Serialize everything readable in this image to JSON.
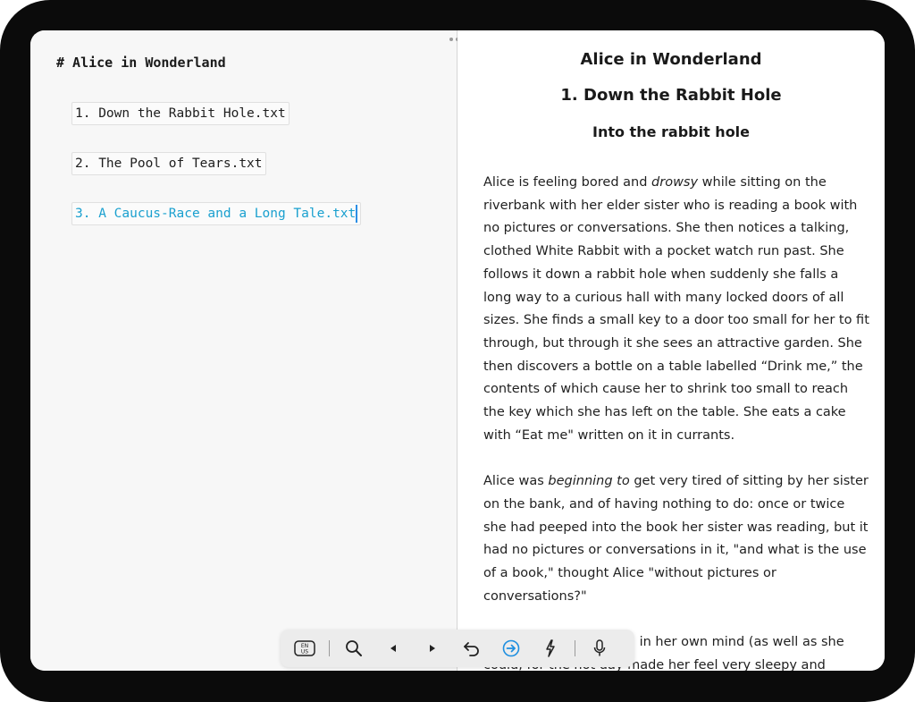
{
  "editor": {
    "heading": "# Alice in Wonderland",
    "files": [
      {
        "label": "1. Down the Rabbit Hole.txt"
      },
      {
        "label": "2. The Pool of Tears.txt"
      },
      {
        "label": "3. A Caucus-Race and a Long Tale.txt"
      }
    ]
  },
  "preview": {
    "title": "Alice in Wonderland",
    "chapter_heading": "1. Down the Rabbit Hole",
    "section_heading": "Into the rabbit hole",
    "para1": {
      "a": " Alice is feeling bored and ",
      "em": "drowsy",
      "b": " while sitting on the riverbank with her elder sister who is reading a book with no pictures or conversations. She then notices a talking, clothed White Rabbit with a pocket watch run past. She follows it down a rabbit hole when suddenly she falls a long way to a curious hall with many locked doors of all sizes. She finds a small key to a door too small for her to fit through, but through it she sees an attractive garden. She then discovers a bottle on a table labelled “Drink me,” the contents of which cause her to shrink too small to reach the key which she has left on the table. She eats a cake with “Eat me\" written on it in currants."
    },
    "para2": {
      "a": "Alice was ",
      "em": "beginning to",
      "b": " get very tired of sitting by her sister on the bank, and of having nothing to do: once or twice she had peeped into the book her sister was reading, but it had no pictures or conversations in it, \"and what is the use of a book,\" thought Alice \"without pictures or conversations?\""
    },
    "para3": "So she was considering in her own mind (as well as she could, for the hot day made her feel very sleepy and stupid), whether the pleasure of making a daisy-chain"
  },
  "toolbar": {
    "keyboard_lang": [
      "EN",
      "US"
    ],
    "buttons": [
      {
        "icon": "keyboard-language-icon"
      },
      {
        "icon": "search-icon"
      },
      {
        "icon": "cursor-left-icon"
      },
      {
        "icon": "cursor-right-icon"
      },
      {
        "icon": "undo-icon"
      },
      {
        "icon": "go-forward-icon"
      },
      {
        "icon": "lightning-icon"
      },
      {
        "icon": "microphone-icon"
      }
    ],
    "accent_color": "#1e8fe0"
  },
  "colors": {
    "editor_bg": "#f7f7f7",
    "link_active": "#1aa0cf",
    "device_frame": "#0b0b0b"
  }
}
